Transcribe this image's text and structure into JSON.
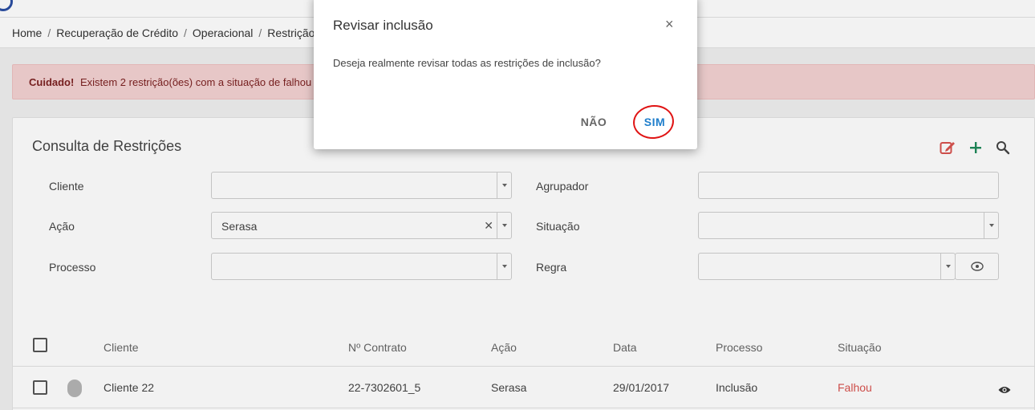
{
  "breadcrumb": {
    "items": [
      "Home",
      "Recuperação de Crédito",
      "Operacional",
      "Restrição"
    ],
    "separator": "/"
  },
  "alert": {
    "strong": "Cuidado!",
    "text": "Existem 2 restrição(ões) com a situação de falhou"
  },
  "panel": {
    "title": "Consulta de Restrições",
    "icons": {
      "edit": "edit-icon",
      "add": "plus-icon",
      "search": "search-icon"
    }
  },
  "form": {
    "cliente": {
      "label": "Cliente",
      "value": ""
    },
    "agrupador": {
      "label": "Agrupador",
      "value": ""
    },
    "acao": {
      "label": "Ação",
      "value": "Serasa"
    },
    "situacao": {
      "label": "Situação",
      "value": ""
    },
    "processo": {
      "label": "Processo",
      "value": ""
    },
    "regra": {
      "label": "Regra",
      "value": ""
    }
  },
  "table": {
    "headers": {
      "cliente": "Cliente",
      "contrato": "Nº Contrato",
      "acao": "Ação",
      "data": "Data",
      "processo": "Processo",
      "situacao": "Situação"
    },
    "rows": [
      {
        "cliente": "Cliente 22",
        "contrato": "22-7302601_5",
        "acao": "Serasa",
        "data": "29/01/2017",
        "processo": "Inclusão",
        "situacao": "Falhou"
      }
    ]
  },
  "modal": {
    "title": "Revisar inclusão",
    "close": "×",
    "message": "Deseja realmente revisar todas as restrições de inclusão?",
    "no_label": "NÃO",
    "yes_label": "SIM"
  },
  "colors": {
    "accent_blue": "#1f7ecb",
    "danger_red": "#d9534f",
    "alert_bg": "#f4d2d2",
    "annotation_red": "#e01414",
    "add_green": "#1f8a5a"
  }
}
